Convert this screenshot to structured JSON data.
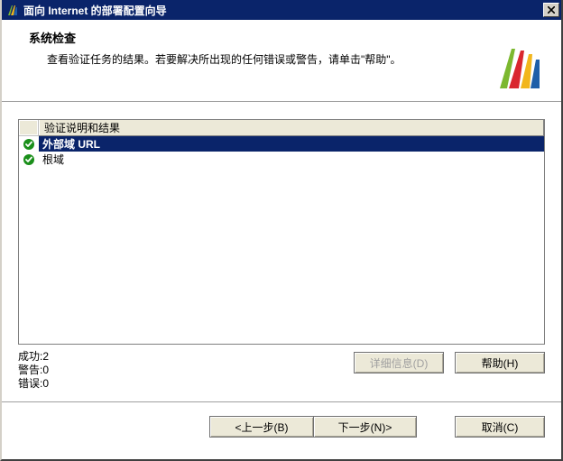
{
  "window": {
    "title": "面向 Internet 的部署配置向导"
  },
  "header": {
    "title": "系统检查",
    "description": "查看验证任务的结果。若要解决所出现的任何错误或警告，请单击\"帮助\"。"
  },
  "list": {
    "column_header": "验证说明和结果",
    "rows": [
      {
        "status": "success",
        "label": "外部域 URL",
        "selected": true
      },
      {
        "status": "success",
        "label": "根域",
        "selected": false
      }
    ]
  },
  "stats": {
    "success_label": "成功",
    "success_value": "2",
    "warning_label": "警告",
    "warning_value": "0",
    "error_label": "错误",
    "error_value": "0"
  },
  "buttons": {
    "details": "详细信息(D)",
    "help": "帮助(H)",
    "back": "<上一步(B)",
    "next": "下一步(N)>",
    "cancel": "取消(C)"
  },
  "colors": {
    "titlebar": "#0a246a",
    "selection": "#0a246a",
    "success_icon": "#1a8f1a"
  }
}
